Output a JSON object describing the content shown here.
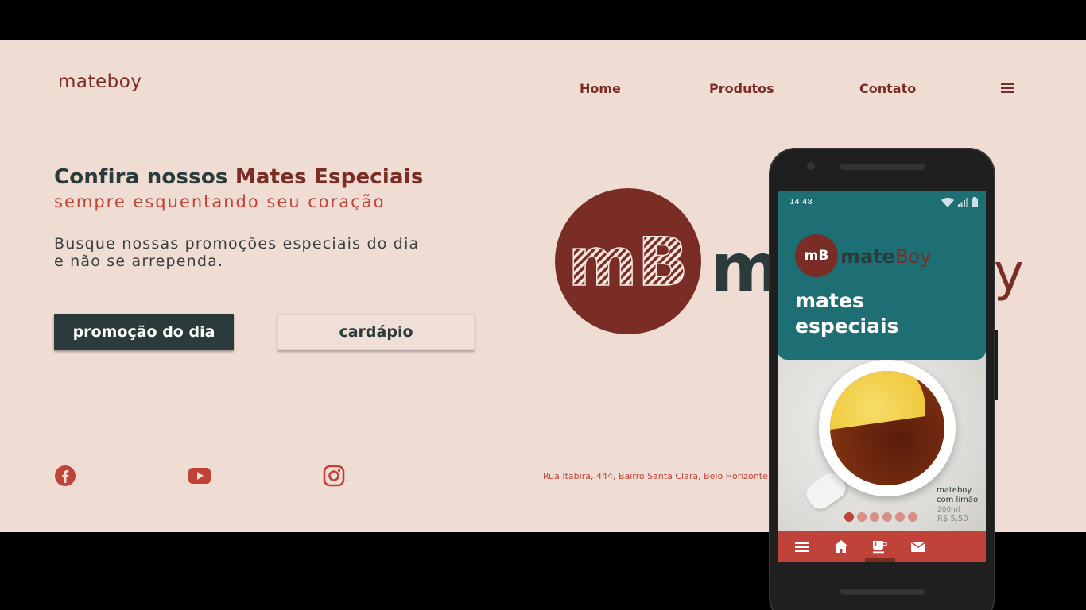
{
  "brand": {
    "logo": "mateboy"
  },
  "nav": {
    "home": "Home",
    "produtos": "Produtos",
    "contato": "Contato"
  },
  "hero": {
    "title_prefix": "Confira nossos ",
    "title_accent": "Mates Especiais",
    "subtitle": "sempre esquentando seu coração",
    "description": "Busque nossas promoções especiais do dia e não se arrependa.",
    "btn_promo": "promoção do dia",
    "btn_cardapio": "cardápio"
  },
  "big_logo": {
    "monogram": "mB",
    "word": "m",
    "tail": "y"
  },
  "footer": {
    "address": "Rua Itabira, 444, Bairro Santa Clara, Belo Horizonte"
  },
  "phone": {
    "time": "14:48",
    "logo_monogram": "mB",
    "logo_mate": "mate",
    "logo_boy": "Boy",
    "heading": "mates especiais",
    "product": {
      "name": "mateboy com limão",
      "size": "200ml",
      "price": "R$ 5,50"
    }
  },
  "colors": {
    "background": "#efddd4",
    "brand_red": "#7a2d25",
    "accent_red": "#c0433a",
    "dark": "#2b3b3b",
    "teal": "#1d6f74"
  },
  "icons": [
    "menu-icon",
    "facebook-icon",
    "youtube-icon",
    "instagram-icon",
    "wifi-icon",
    "signal-icon",
    "battery-icon",
    "home-icon",
    "coffee-icon",
    "mail-icon"
  ]
}
